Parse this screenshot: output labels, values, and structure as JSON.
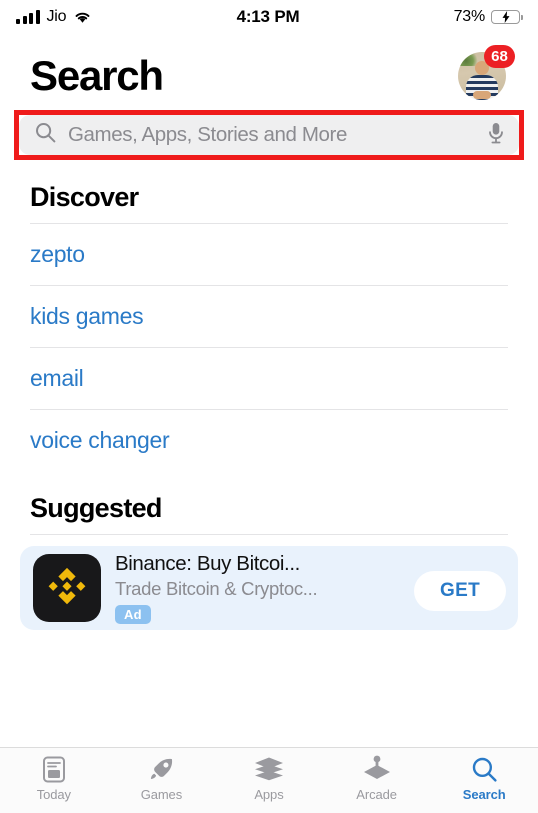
{
  "status_bar": {
    "carrier": "Jio",
    "time": "4:13 PM",
    "battery_percent": "73%",
    "battery_level": 73,
    "charging": true,
    "signal_bars": 4,
    "wifi_icon": "wifi-icon",
    "battery_icon": "battery-charging-icon"
  },
  "header": {
    "title": "Search",
    "avatar_badge": "68",
    "avatar_icon": "user-avatar"
  },
  "search": {
    "placeholder": "Games, Apps, Stories and More",
    "value": "",
    "search_icon": "search-icon",
    "mic_icon": "microphone-icon",
    "annotation_color": "#ef1b1b",
    "field_color": "#efeff0"
  },
  "discover": {
    "title": "Discover",
    "items": [
      {
        "label": "zepto"
      },
      {
        "label": "kids games"
      },
      {
        "label": "email"
      },
      {
        "label": "voice changer"
      }
    ],
    "link_color": "#2a7ac7"
  },
  "suggested": {
    "title": "Suggested",
    "app": {
      "name": "Binance: Buy Bitcoi...",
      "subtitle": "Trade Bitcoin & Cryptoc...",
      "ad_label": "Ad",
      "get_label": "GET",
      "icon_name": "binance-app-icon",
      "icon_bg": "#18181a",
      "icon_fg": "#f0b90b",
      "card_bg": "#e9f2fc"
    }
  },
  "tab_bar": {
    "tabs": [
      {
        "label": "Today",
        "icon": "today-icon",
        "active": false
      },
      {
        "label": "Games",
        "icon": "rocket-icon",
        "active": false
      },
      {
        "label": "Apps",
        "icon": "apps-stack-icon",
        "active": false
      },
      {
        "label": "Arcade",
        "icon": "arcade-joystick-icon",
        "active": false
      },
      {
        "label": "Search",
        "icon": "search-icon",
        "active": true
      }
    ],
    "active_color": "#2a7ac7",
    "inactive_color": "#9a9a9f"
  }
}
